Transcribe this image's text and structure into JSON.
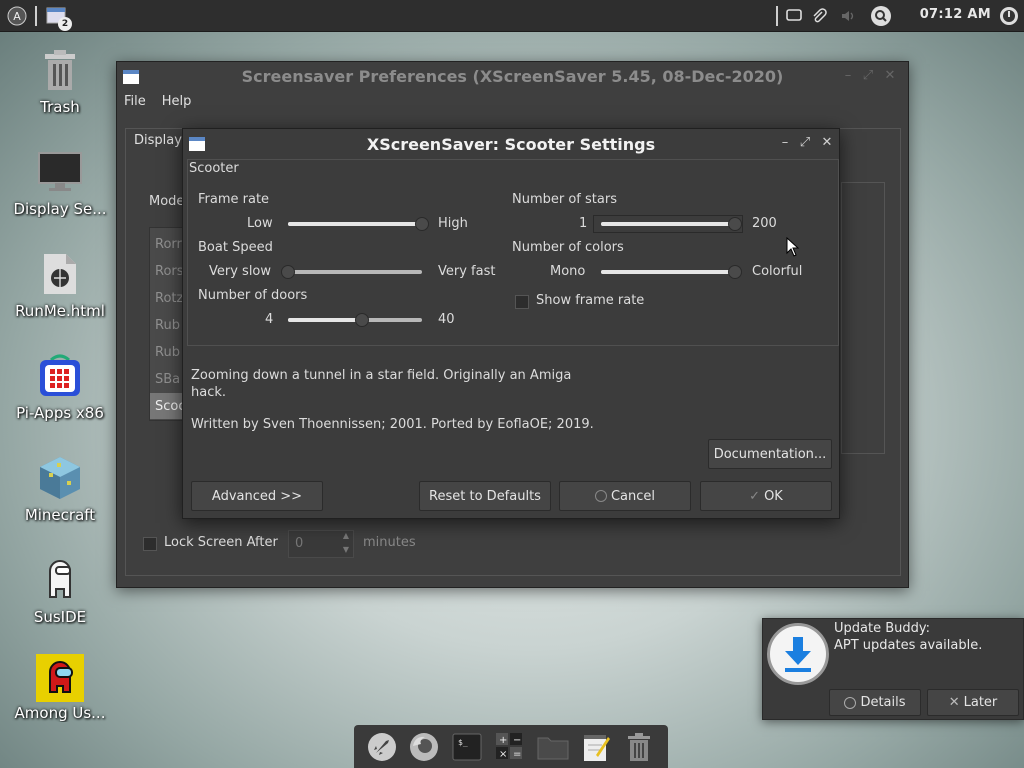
{
  "top_panel": {
    "workspace_badge": "2",
    "clock": "07:12 AM"
  },
  "desktop": {
    "icons": [
      {
        "label": "Trash"
      },
      {
        "label": "Display Se..."
      },
      {
        "label": "RunMe.html"
      },
      {
        "label": "Pi-Apps x86"
      },
      {
        "label": "Minecraft"
      },
      {
        "label": "SusIDE"
      },
      {
        "label": "Among Us..."
      }
    ]
  },
  "back_window": {
    "title": "Screensaver Preferences  (XScreenSaver 5.45, 08-Dec-2020)",
    "menu": {
      "file": "File",
      "help": "Help"
    },
    "tab_display": "Display",
    "mode_label": "Mode",
    "list_items": [
      "Rorr",
      "Rors",
      "Rotz",
      "Rub",
      "Rub",
      "SBa",
      "Scoo"
    ],
    "lock_label": "Lock Screen After",
    "lock_value": "0",
    "lock_unit": "minutes"
  },
  "front_window": {
    "title": "XScreenSaver: Scooter Settings",
    "group_label": "Scooter",
    "frame_rate": {
      "label": "Frame rate",
      "low": "Low",
      "high": "High",
      "value": 1.0
    },
    "boat_speed": {
      "label": "Boat Speed",
      "low": "Very slow",
      "high": "Very fast",
      "value": 0.0
    },
    "doors": {
      "label": "Number of doors",
      "low": "4",
      "high": "40",
      "value": 0.55
    },
    "stars": {
      "label": "Number of stars",
      "low": "1",
      "high": "200",
      "value": 1.0
    },
    "colors": {
      "label": "Number of colors",
      "low": "Mono",
      "high": "Colorful",
      "value": 1.0
    },
    "show_frame_rate": {
      "label": "Show frame rate",
      "checked": false
    },
    "description": "Zooming down a tunnel in a star field. Originally an Amiga hack.",
    "credits": "Written by Sven Thoennissen; 2001. Ported by EoflaOE; 2019.",
    "buttons": {
      "documentation": "Documentation...",
      "advanced": "Advanced >>",
      "reset": "Reset to Defaults",
      "cancel": "Cancel",
      "ok": "OK"
    }
  },
  "notification": {
    "title": "Update Buddy:",
    "message": "APT updates available.",
    "details": "Details",
    "later": "Later"
  },
  "dock": {
    "items": [
      "rocket-icon",
      "firefox-icon",
      "terminal-icon",
      "calculator-icon",
      "folder-icon",
      "text-editor-icon",
      "trash-icon"
    ]
  }
}
